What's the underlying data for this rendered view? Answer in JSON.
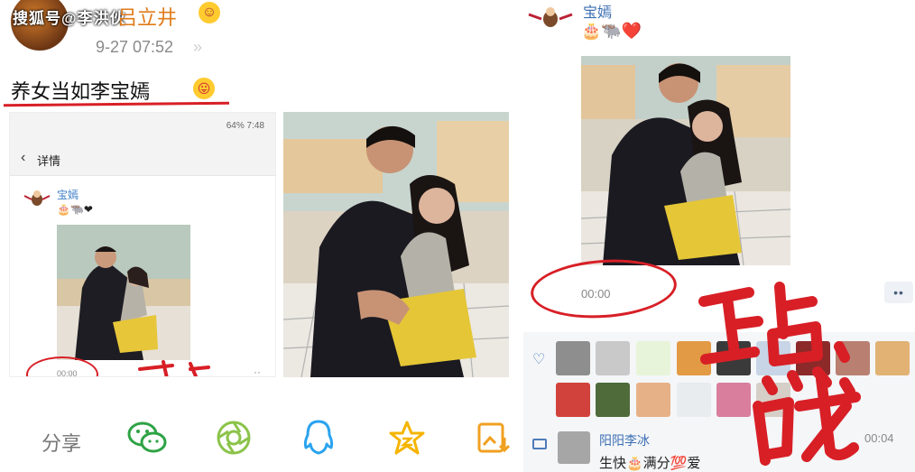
{
  "left": {
    "watermark": "搜狐号@李洪伙",
    "author": "吕立井",
    "post_time": "9-27 07:52",
    "post_time_sep": "»",
    "headline": "养女当如李宝嫣",
    "phone": {
      "status_text": "64% 7:48",
      "back_glyph": "‹",
      "title": "详情",
      "poster_name": "宝嫣",
      "emojis": "🎂🐃❤",
      "video_time": "00:00",
      "more_dots": "··"
    }
  },
  "share": {
    "label": "分享",
    "icons": [
      "wechat-icon",
      "moments-icon",
      "qq-icon",
      "qzone-icon",
      "save-image-icon"
    ]
  },
  "right": {
    "poster_name": "宝嫣",
    "emojis": "🎂🐃❤️",
    "video_time": "00:00",
    "more_dots": "••",
    "comment": {
      "user": "阳阳李冰",
      "text": "生快🎂满分💯爱",
      "time": "00:04"
    }
  },
  "colors": {
    "accent_orange": "#e07b19",
    "link_blue": "#3c6fb3",
    "annotation_red": "#d81f26",
    "likes_bg": "#f4f6f8"
  }
}
